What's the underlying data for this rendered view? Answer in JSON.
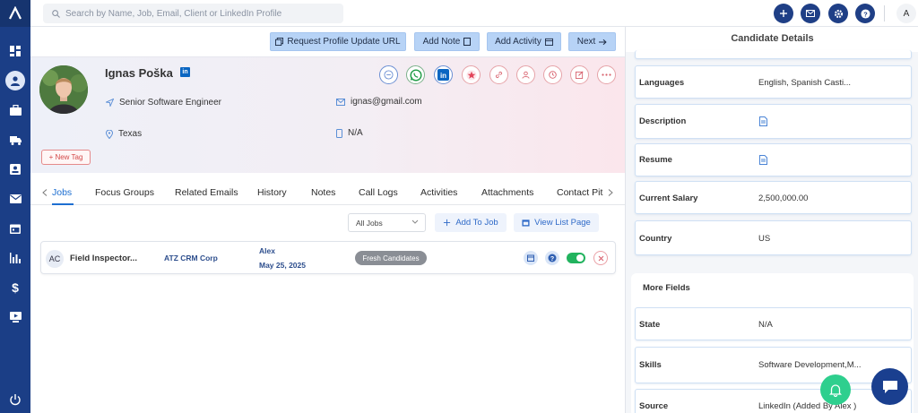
{
  "search": {
    "placeholder": "Search by Name, Job, Email, Client or LinkedIn Profile"
  },
  "topbar": {
    "avatar": "A"
  },
  "actions": {
    "request_update": "Request Profile Update URL",
    "add_note": "Add Note",
    "add_activity": "Add Activity",
    "next": "Next"
  },
  "candidate": {
    "name": "Ignas Poška",
    "linkedin_badge": "in",
    "title": "Senior Software Engineer",
    "location": "Texas",
    "email": "ignas@gmail.com",
    "phone": "N/A",
    "new_tag": "+ New Tag"
  },
  "tabs": [
    "Jobs",
    "Focus Groups",
    "Related Emails",
    "History",
    "Notes",
    "Call Logs",
    "Activities",
    "Attachments",
    "Contact Pit"
  ],
  "jobs_toolbar": {
    "filter": "All Jobs",
    "add_to_job": "Add To Job",
    "view_list": "View List Page"
  },
  "job_row": {
    "initials": "AC",
    "title": "Field Inspector...",
    "client": "ATZ CRM Corp",
    "owner": "Alex",
    "date": "May 25, 2025",
    "stage": "Fresh Candidates",
    "active": true
  },
  "details": {
    "header": "Candidate Details",
    "languages": {
      "label": "Languages",
      "value": "English, Spanish Casti..."
    },
    "description": {
      "label": "Description"
    },
    "resume": {
      "label": "Resume"
    },
    "salary": {
      "label": "Current Salary",
      "value": "2,500,000.00"
    },
    "country": {
      "label": "Country",
      "value": "US"
    },
    "more_fields": "More Fields",
    "state": {
      "label": "State",
      "value": "N/A"
    },
    "skills": {
      "label": "Skills",
      "value": "Software Development,M..."
    },
    "source": {
      "label": "Source",
      "value": "LinkedIn (Added By Alex )"
    }
  },
  "colors": {
    "sidebar": "#1b3e86",
    "accent": "#1e6fd1",
    "action_button": "#b7d3f6",
    "toggle_on": "#22b35e",
    "bell": "#2ecf8e"
  }
}
